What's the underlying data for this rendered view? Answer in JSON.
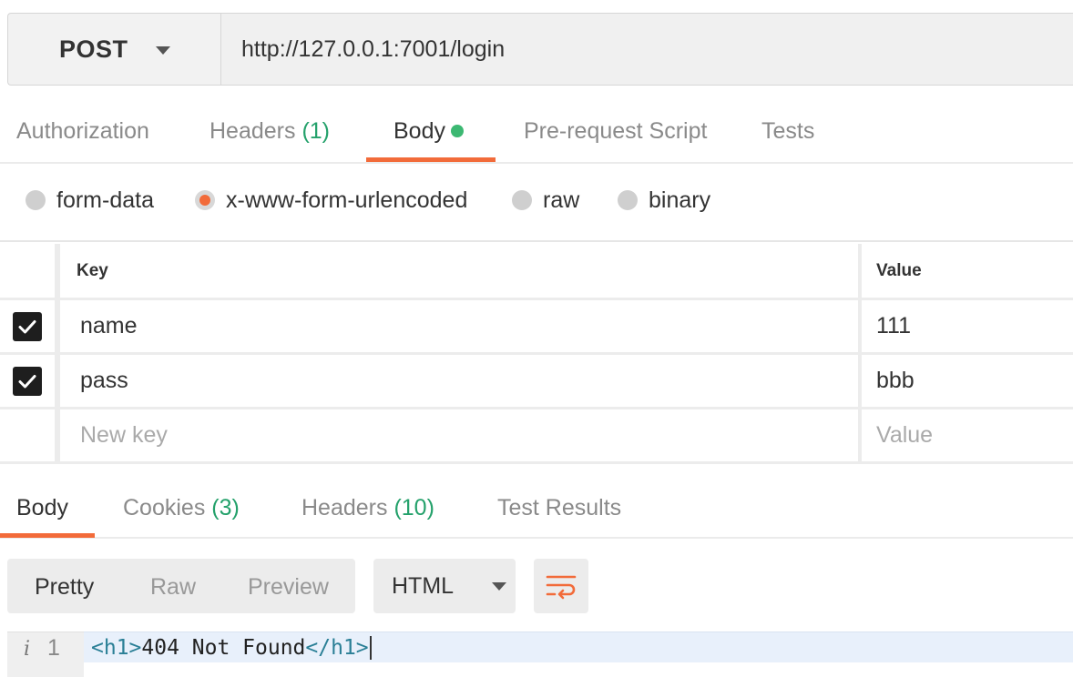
{
  "request": {
    "method": "POST",
    "url": "http://127.0.0.1:7001/login"
  },
  "request_tabs": [
    {
      "label": "Authorization",
      "count": ""
    },
    {
      "label": "Headers",
      "count": "(1)"
    },
    {
      "label": "Body",
      "count": ""
    },
    {
      "label": "Pre-request Script",
      "count": ""
    },
    {
      "label": "Tests",
      "count": ""
    }
  ],
  "body_types": [
    {
      "label": "form-data",
      "selected": false
    },
    {
      "label": "x-www-form-urlencoded",
      "selected": true
    },
    {
      "label": "raw",
      "selected": false
    },
    {
      "label": "binary",
      "selected": false
    }
  ],
  "params_table": {
    "key_header": "Key",
    "value_header": "Value",
    "rows": [
      {
        "key": "name",
        "value": "111",
        "checked": true
      },
      {
        "key": "pass",
        "value": "bbb",
        "checked": true
      }
    ],
    "new_key_placeholder": "New key",
    "new_value_placeholder": "Value"
  },
  "response_tabs": [
    {
      "label": "Body",
      "count": ""
    },
    {
      "label": "Cookies",
      "count": "(3)"
    },
    {
      "label": "Headers",
      "count": "(10)"
    },
    {
      "label": "Test Results",
      "count": ""
    }
  ],
  "response_view": {
    "modes": [
      "Pretty",
      "Raw",
      "Preview"
    ],
    "active_mode": "Pretty",
    "language": "HTML"
  },
  "code": {
    "line_number": "1",
    "open_tag": "<h1>",
    "text": "404 Not Found",
    "close_tag": "</h1>"
  },
  "colors": {
    "accent": "#f26b3a",
    "count_green": "#24a16b",
    "status_dot": "#3cb872"
  }
}
